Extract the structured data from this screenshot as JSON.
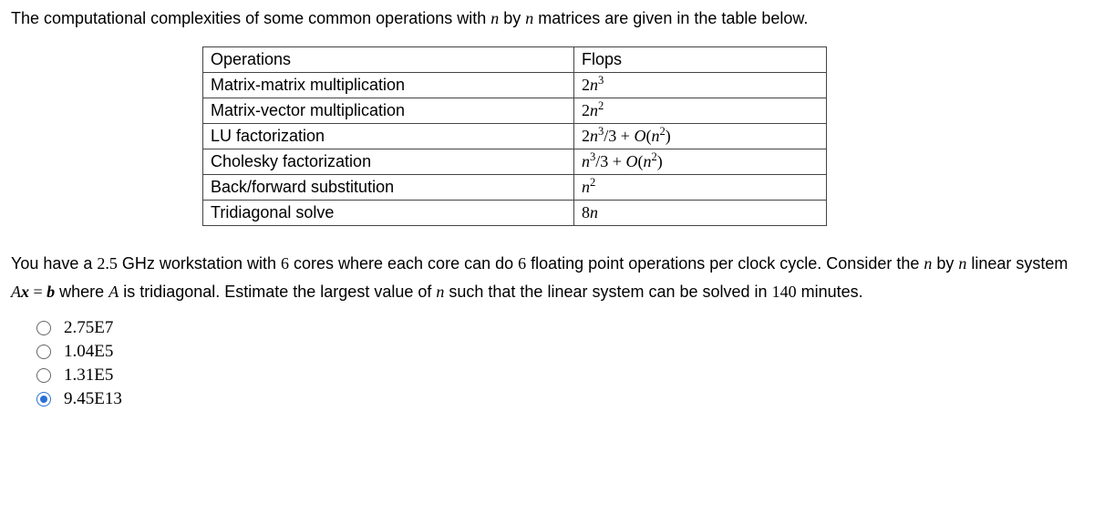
{
  "intro": {
    "prefix": "The computational complexities of some common operations with ",
    "nvar": "n",
    "by": " by ",
    "suffix": " matrices are given in the table below."
  },
  "table": {
    "headers": {
      "op": "Operations",
      "flops": "Flops"
    },
    "rows": [
      {
        "op": "Matrix-matrix multiplication",
        "flops_html": "2<span class=\"mathit\">n</span><sup>3</sup>"
      },
      {
        "op": "Matrix-vector multiplication",
        "flops_html": "2<span class=\"mathit\">n</span><sup>2</sup>"
      },
      {
        "op": "LU factorization",
        "flops_html": "2<span class=\"mathit\">n</span><sup>3</sup>/3 + <span class=\"calO\">O</span>(<span class=\"mathit\">n</span><sup>2</sup>)"
      },
      {
        "op": "Cholesky factorization",
        "flops_html": "<span class=\"mathit\">n</span><sup>3</sup>/3 + <span class=\"calO\">O</span>(<span class=\"mathit\">n</span><sup>2</sup>)"
      },
      {
        "op": "Back/forward substitution",
        "flops_html": "<span class=\"mathit\">n</span><sup>2</sup>"
      },
      {
        "op": "Tridiagonal solve",
        "flops_html": "8<span class=\"mathit\">n</span>"
      }
    ]
  },
  "question": {
    "p1": "You have a ",
    "ghz": "2.5",
    "p2": " GHz workstation with ",
    "cores": "6",
    "p3": " cores where each core can do ",
    "flops_per_cycle": "6",
    "p4": " floating point operations per clock cycle. Consider the ",
    "nvar": "n",
    "p5": " by ",
    "p6": " linear system ",
    "Ax": "A",
    "xvar": "x",
    "eq": " = ",
    "bvar": "b",
    "p7": " where ",
    "Avar": "A",
    "p8": " is tridiagonal. Estimate the largest value of ",
    "p9": " such that the linear system can be solved in ",
    "minutes": "140",
    "p10": " minutes."
  },
  "options": [
    {
      "label": "2.75E7",
      "selected": false
    },
    {
      "label": "1.04E5",
      "selected": false
    },
    {
      "label": "1.31E5",
      "selected": false
    },
    {
      "label": "9.45E13",
      "selected": true
    }
  ]
}
